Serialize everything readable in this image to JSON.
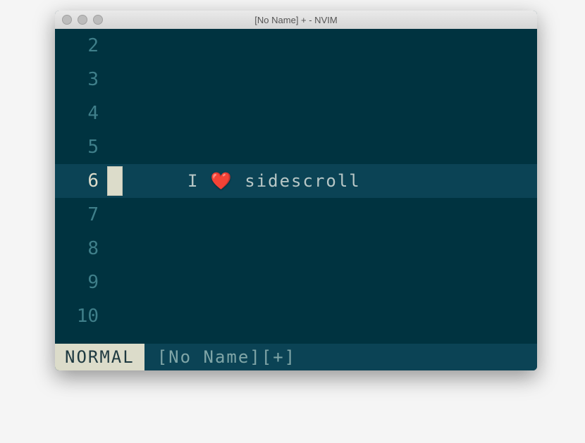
{
  "window": {
    "title": "[No Name] + - NVIM"
  },
  "editor": {
    "rows": [
      {
        "num": "2",
        "current": false
      },
      {
        "num": "3",
        "current": false
      },
      {
        "num": "4",
        "current": false
      },
      {
        "num": "5",
        "current": false
      },
      {
        "num": "6",
        "current": true,
        "text_before": "I ",
        "heart": "❤️",
        "text_after": " sidescroll"
      },
      {
        "num": "7",
        "current": false
      },
      {
        "num": "8",
        "current": false
      },
      {
        "num": "9",
        "current": false
      },
      {
        "num": "10",
        "current": false
      }
    ]
  },
  "status": {
    "mode": "NORMAL",
    "file": "[No Name][+]"
  }
}
